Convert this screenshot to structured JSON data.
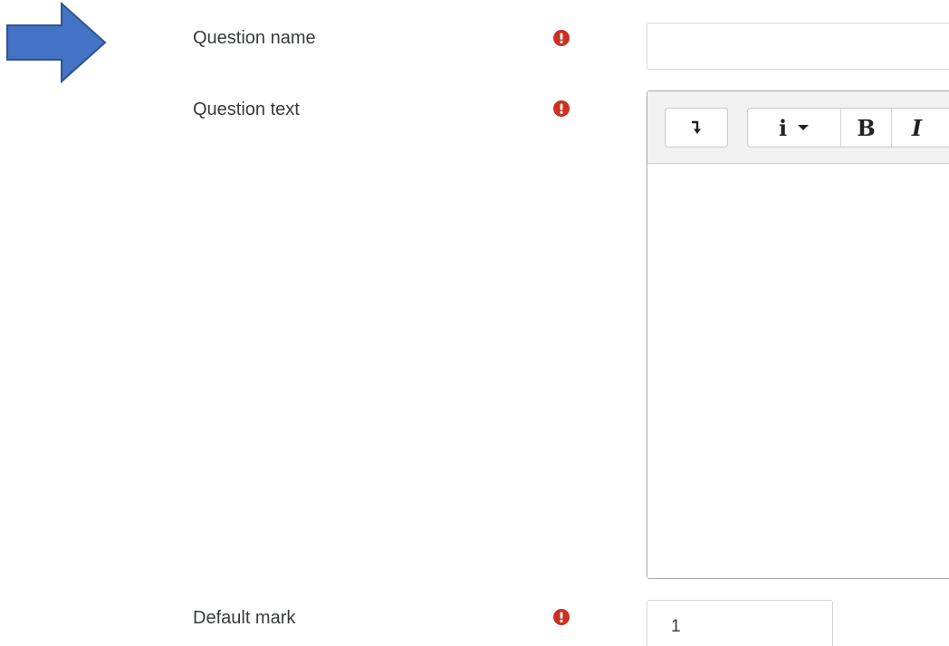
{
  "annotation": {
    "arrow_color": "#4472c4",
    "arrow_outline": "#2f528f",
    "icon": "arrow-right-icon"
  },
  "form": {
    "question_name": {
      "label": "Question name",
      "required_icon": "exclamation-circle-icon",
      "value": ""
    },
    "question_text": {
      "label": "Question text",
      "required_icon": "exclamation-circle-icon",
      "toolbar": {
        "collapse_icon": "toolbar-collapse-icon",
        "info_label": "i",
        "info_dropdown_icon": "caret-down-icon",
        "bold_label": "B",
        "italic_label": "I"
      },
      "value": ""
    },
    "default_mark": {
      "label": "Default mark",
      "required_icon": "exclamation-circle-icon",
      "value": "1"
    }
  },
  "colors": {
    "required": "#ca3120",
    "label_text": "#373a3c"
  }
}
